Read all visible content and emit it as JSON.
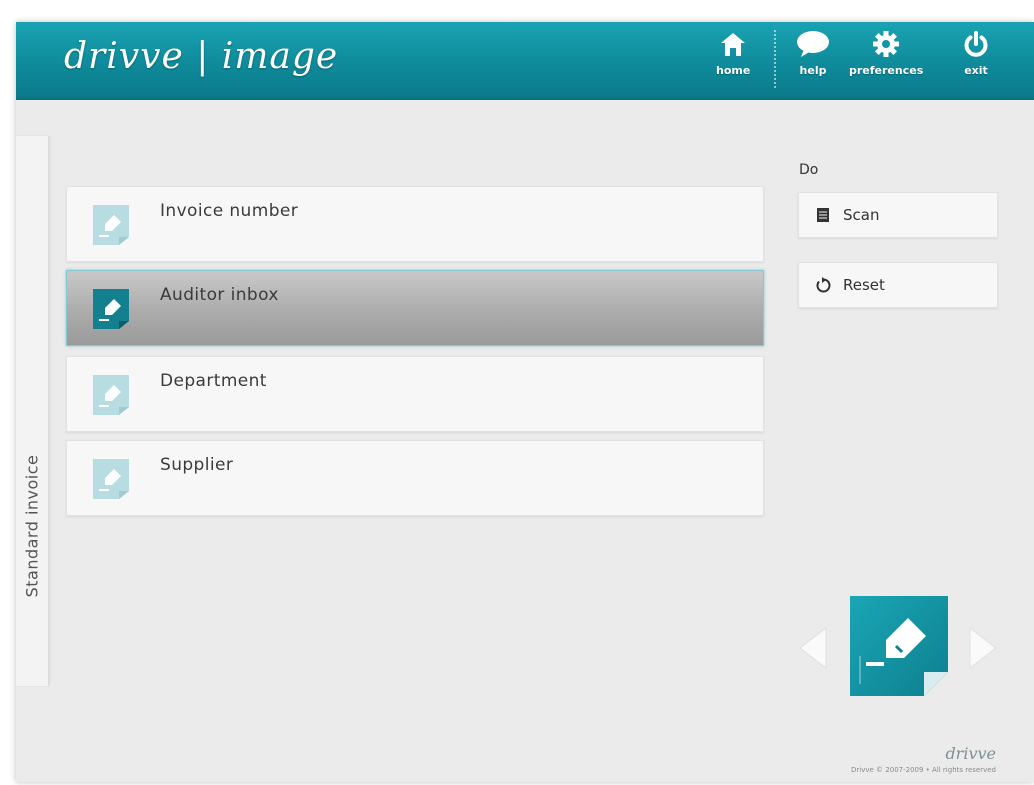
{
  "header": {
    "logo_text": "drivve | image",
    "nav": [
      {
        "label": "home",
        "icon": "home-icon"
      },
      {
        "label": "help",
        "icon": "speech-bubble-icon"
      },
      {
        "label": "preferences",
        "icon": "gear-icon"
      },
      {
        "label": "exit",
        "icon": "power-icon"
      }
    ]
  },
  "side_tab": {
    "label": "Standard invoice"
  },
  "fields": [
    {
      "label": "Invoice number",
      "icon": "document-pen-icon",
      "selected": false
    },
    {
      "label": "Auditor inbox",
      "icon": "document-pen-icon",
      "selected": true
    },
    {
      "label": "Department",
      "icon": "document-pen-icon",
      "selected": false
    },
    {
      "label": "Supplier",
      "icon": "document-pen-icon",
      "selected": false
    }
  ],
  "actions": {
    "heading": "Do",
    "items": [
      {
        "label": "Scan",
        "icon": "scanner-icon"
      },
      {
        "label": "Reset",
        "icon": "reset-icon"
      }
    ]
  },
  "carousel": {
    "prev_icon": "chevron-left-icon",
    "next_icon": "chevron-right-icon",
    "current_icon": "document-pen-icon"
  },
  "footer": {
    "brand": "drivve",
    "copyright": "Drivve © 2007-2009 • All rights reserved"
  },
  "colors": {
    "accent": "#0f8b9b",
    "background": "#ebebeb"
  }
}
